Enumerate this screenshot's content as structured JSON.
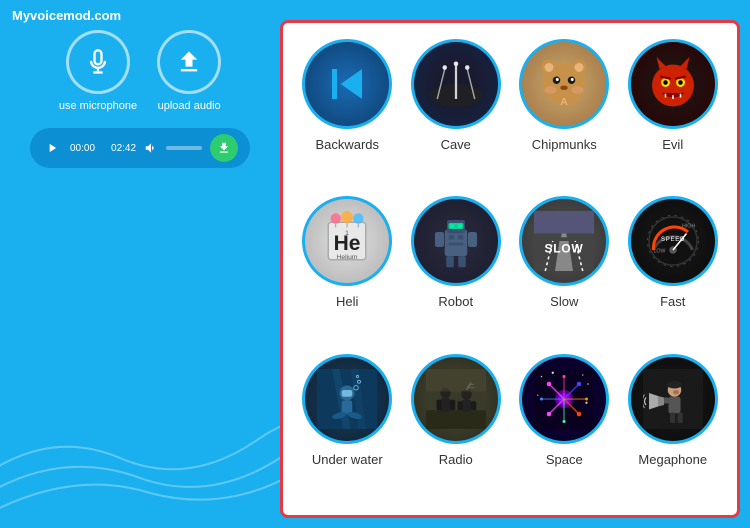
{
  "site": {
    "url": "Myvoicemod.com"
  },
  "left_panel": {
    "mic_label": "use microphone",
    "upload_label": "upload audio",
    "player": {
      "time_current": "00:00",
      "time_total": "02:42"
    }
  },
  "effects": [
    {
      "id": "backwards",
      "label": "Backwards",
      "style": "backwards"
    },
    {
      "id": "cave",
      "label": "Cave",
      "style": "cave"
    },
    {
      "id": "chipmunks",
      "label": "Chipmunks",
      "style": "chipmunks"
    },
    {
      "id": "evil",
      "label": "Evil",
      "style": "evil"
    },
    {
      "id": "heli",
      "label": "Heli",
      "style": "heli"
    },
    {
      "id": "robot",
      "label": "Robot",
      "style": "robot"
    },
    {
      "id": "slow",
      "label": "Slow",
      "style": "slow"
    },
    {
      "id": "fast",
      "label": "Fast",
      "style": "fast"
    },
    {
      "id": "underwater",
      "label": "Under water",
      "style": "underwater"
    },
    {
      "id": "radio",
      "label": "Radio",
      "style": "radio"
    },
    {
      "id": "space",
      "label": "Space",
      "style": "space"
    },
    {
      "id": "megaphone",
      "label": "Megaphone",
      "style": "megaphone"
    }
  ]
}
